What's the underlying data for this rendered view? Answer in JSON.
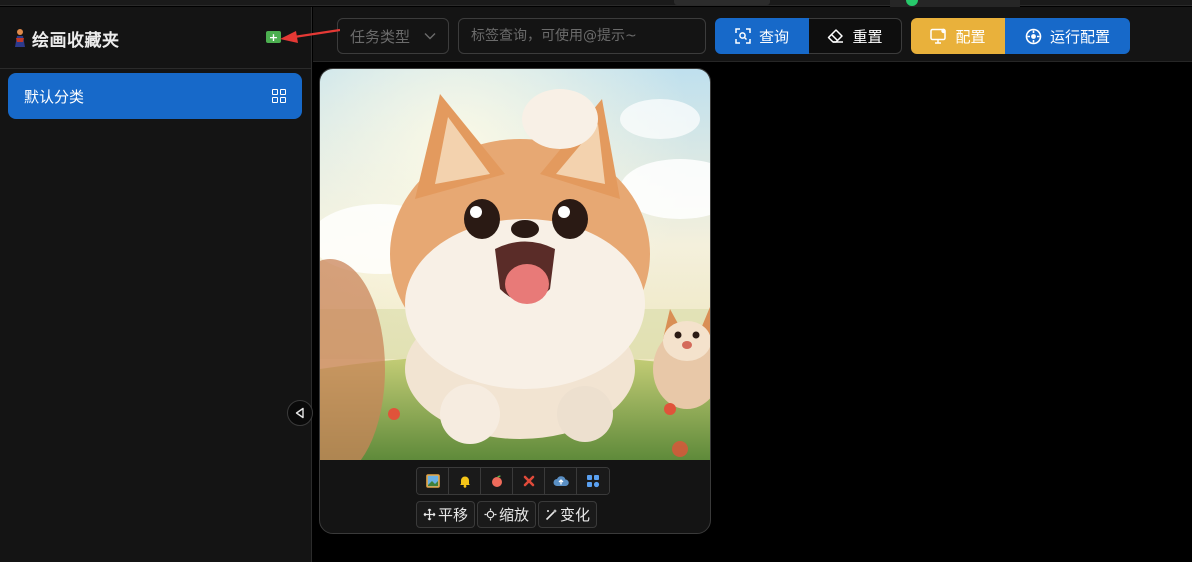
{
  "sidebar": {
    "title": "绘画收藏夹",
    "add_label": "+",
    "items": [
      {
        "label": "默认分类"
      }
    ]
  },
  "toolbar": {
    "task_type_placeholder": "任务类型",
    "search_placeholder": "标签查询，可使用@提示~",
    "query_label": "查询",
    "reset_label": "重置",
    "config_label": "配置",
    "run_config_label": "运行配置"
  },
  "card": {
    "icons": [
      "image-icon",
      "bell-icon",
      "peach-icon",
      "close-icon",
      "cloud-upload-icon",
      "apps-icon"
    ],
    "actions": [
      {
        "label": "平移",
        "icon": "move-icon"
      },
      {
        "label": "缩放",
        "icon": "zoom-icon"
      },
      {
        "label": "变化",
        "icon": "magic-wand-icon"
      }
    ]
  },
  "colors": {
    "primary": "#1769c9",
    "config": "#e9b13b",
    "add": "#4caf50",
    "arrow": "#e53935"
  }
}
